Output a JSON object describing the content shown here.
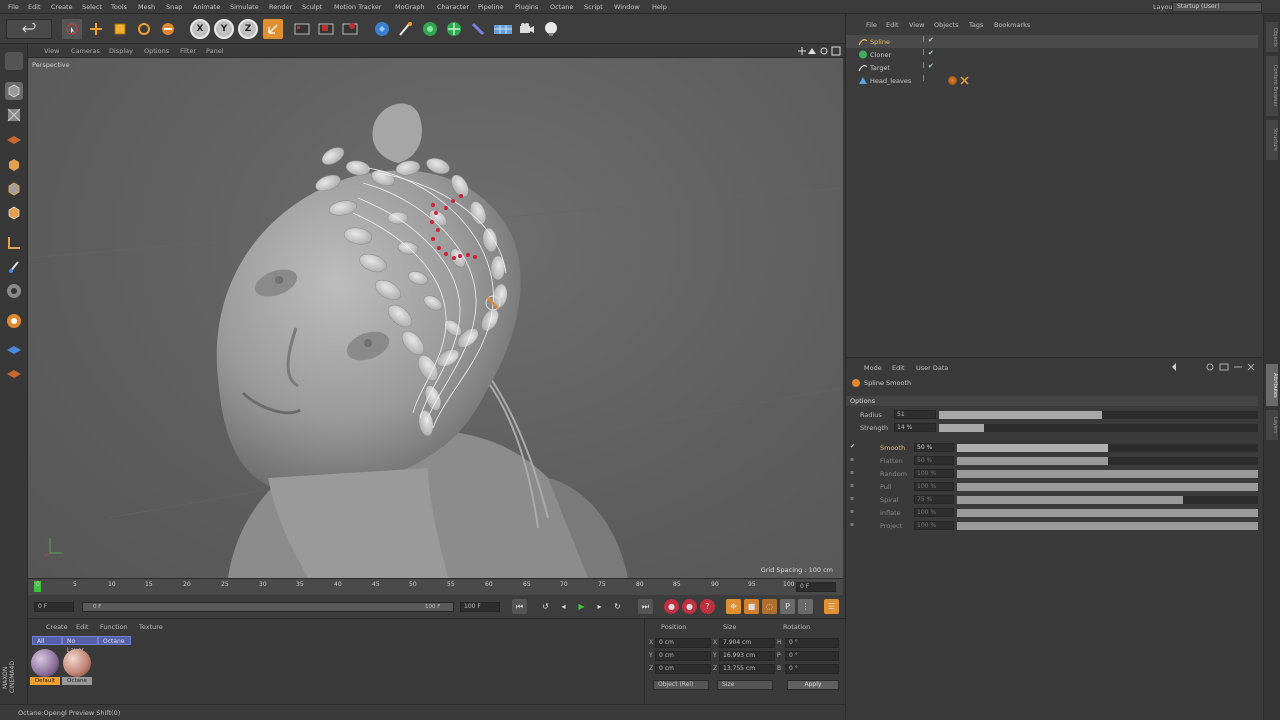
{
  "menubar": {
    "items": [
      "File",
      "Edit",
      "Create",
      "Select",
      "Tools",
      "Mesh",
      "Snap",
      "Animate",
      "Simulate",
      "Render",
      "Sculpt",
      "Motion Tracker",
      "MoGraph",
      "Character",
      "Pipeline",
      "Plugins",
      "Octane",
      "Script",
      "Window",
      "Help"
    ],
    "layout_label": "Layout:",
    "layout_value": "Startup (User)"
  },
  "toolbar": {
    "icons": [
      "undo-icon",
      "live-selection-icon",
      "move-icon",
      "scale-icon",
      "rotate-icon",
      "recent-tools-icon",
      "x-axis-icon",
      "y-axis-icon",
      "z-axis-icon",
      "coordinate-system-icon",
      "render-view-icon",
      "render-picture-viewer-icon",
      "edit-render-settings-icon",
      "cube-icon",
      "pen-icon",
      "subdivision-icon",
      "array-icon",
      "deformer-icon",
      "floor-icon",
      "camera-icon",
      "light-icon"
    ],
    "axis_labels": [
      "X",
      "Y",
      "Z"
    ]
  },
  "viewport": {
    "menu": [
      "View",
      "Cameras",
      "Display",
      "Options",
      "Filter",
      "Panel"
    ],
    "title": "Perspective",
    "grid_spacing": "Grid Spacing : 100 cm"
  },
  "timeline": {
    "ticks": [
      "0",
      "5",
      "10",
      "15",
      "20",
      "25",
      "30",
      "35",
      "40",
      "45",
      "50",
      "55",
      "60",
      "65",
      "70",
      "75",
      "80",
      "85",
      "90",
      "95",
      "100"
    ],
    "current_frame": "0 F",
    "start_field": "0 F",
    "range_start": "0 F",
    "range_end": "100 F",
    "end_field": "100 F",
    "frame_readout": "0 F",
    "playhead_fraction": 0.0
  },
  "material_manager": {
    "menu": [
      "Create",
      "Edit",
      "Function",
      "Texture"
    ],
    "tabs": [
      "All",
      "No Layer",
      "Octane"
    ],
    "materials": [
      {
        "label": "Default",
        "color": "#8a6e9a",
        "selected": true
      },
      {
        "label": "Octane",
        "color": "#c08070",
        "selected": false
      }
    ]
  },
  "coordinates": {
    "headers": [
      "Position",
      "Size",
      "Rotation"
    ],
    "rows": [
      {
        "axis": "X",
        "pos": "0 cm",
        "size_axis": "X",
        "size": "7.904 cm",
        "rot_axis": "H",
        "rot": "0 °"
      },
      {
        "axis": "Y",
        "pos": "0 cm",
        "size_axis": "Y",
        "size": "16.993 cm",
        "rot_axis": "P",
        "rot": "0 °"
      },
      {
        "axis": "Z",
        "pos": "0 cm",
        "size_axis": "Z",
        "size": "13.755 cm",
        "rot_axis": "B",
        "rot": "0 °"
      }
    ],
    "mode_select": "Object (Rel)",
    "size_select": "Size",
    "apply": "Apply"
  },
  "status": {
    "text": "Octane:Opengl Preview Shift(0)",
    "logo": "MAXON CINEMA4D"
  },
  "object_manager": {
    "menu": [
      "File",
      "Edit",
      "View",
      "Objects",
      "Tags",
      "Bookmarks"
    ],
    "objects": [
      {
        "name": "Spline",
        "color": "#e8c060",
        "selected": true
      },
      {
        "name": "Cloner",
        "color": "#c8c8c8",
        "selected": false
      },
      {
        "name": "Target",
        "color": "#c8c8c8",
        "selected": false
      },
      {
        "name": "Head_leaves",
        "color": "#c8c8c8",
        "selected": false
      }
    ]
  },
  "attribute_manager": {
    "menu": [
      "Mode",
      "Edit",
      "User Data"
    ],
    "tool_name": "Spline Smooth",
    "section": "Options",
    "radius": {
      "label": "Radius",
      "value": "51",
      "fraction": 0.51
    },
    "strength": {
      "label": "Strength",
      "value": "14 %",
      "fraction": 0.14
    },
    "brushes": [
      {
        "label": "Smooth",
        "value": "50 %",
        "fraction": 0.5,
        "active": true
      },
      {
        "label": "Flatten",
        "value": "50 %",
        "fraction": 0.5,
        "active": false
      },
      {
        "label": "Random",
        "value": "100 %",
        "fraction": 1.0,
        "active": false
      },
      {
        "label": "Pull",
        "value": "100 %",
        "fraction": 1.0,
        "active": false
      },
      {
        "label": "Spiral",
        "value": "75 %",
        "fraction": 0.75,
        "active": false
      },
      {
        "label": "Inflate",
        "value": "100 %",
        "fraction": 1.0,
        "active": false
      },
      {
        "label": "Project",
        "value": "100 %",
        "fraction": 1.0,
        "active": false
      }
    ]
  },
  "right_strip": {
    "tabs": [
      "Objects",
      "Content Browser",
      "Structure",
      "Attributes",
      "Layers"
    ]
  },
  "colors": {
    "accent_orange": "#f0a030",
    "selection_yellow": "#e8c060",
    "spline_red": "#d0203a",
    "tab_blue": "#5560a8"
  }
}
